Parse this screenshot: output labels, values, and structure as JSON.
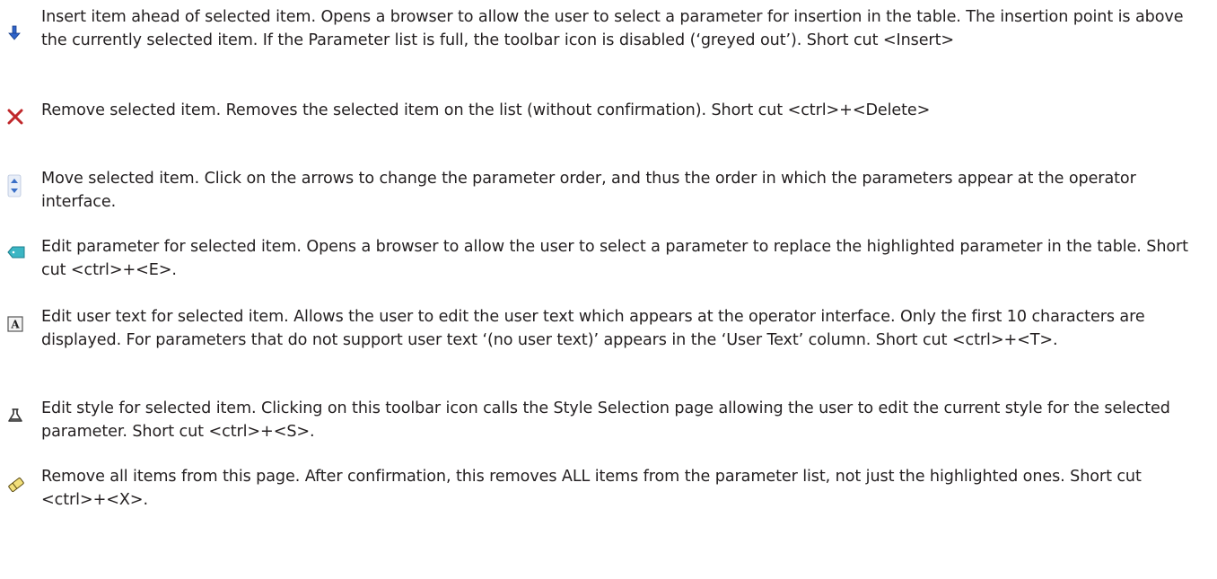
{
  "entries": [
    {
      "icon": "insert-down-arrow-icon",
      "text": "Insert item ahead of selected item. Opens a browser to allow the user to select a parameter for insertion in the table. The insertion point is above the currently selected item. If the Parameter list is full, the toolbar icon is disabled (‘greyed out’). Short cut <Insert>"
    },
    {
      "icon": "remove-x-icon",
      "text": "Remove selected item. Removes the selected item on the list (without confirmation). Short cut <ctrl>+<Delete>"
    },
    {
      "icon": "move-up-down-icon",
      "text": "Move selected item. Click on the arrows to change the parameter order, and thus the order in which the parameters appear at the operator interface."
    },
    {
      "icon": "parameter-tag-icon",
      "text": "Edit parameter for selected item. Opens a browser to allow the user to select a parameter to replace the highlighted parameter in the table. Short cut <ctrl>+<E>."
    },
    {
      "icon": "user-text-a-icon",
      "text": "Edit user text for selected item. Allows the user to edit the user text which appears at the operator interface. Only the first 10 characters are displayed. For parameters that do not support user text ‘(no user text)’ appears in the ‘User Text’ column. Short cut <ctrl>+<T>."
    },
    {
      "icon": "style-flask-icon",
      "text": "Edit style for selected item. Clicking on this toolbar icon calls the Style Selection page allowing the user to edit the current style for the selected parameter. Short cut <ctrl>+<S>."
    },
    {
      "icon": "eraser-icon",
      "text": "Remove all items from this page. After confirmation, this removes ALL items from the parameter list, not just the highlighted ones. Short cut <ctrl>+<X>."
    }
  ]
}
